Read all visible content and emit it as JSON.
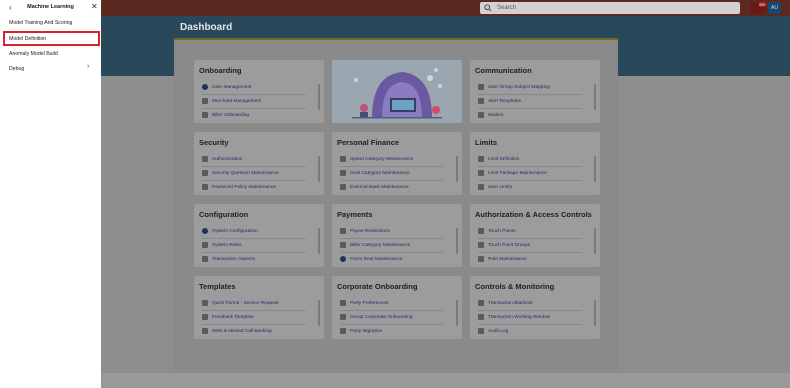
{
  "header": {
    "search_placeholder": "Search",
    "notification_count": "99+",
    "user_initials": "AU"
  },
  "page_title": "Dashboard",
  "drawer": {
    "title": "Machine Learning",
    "items": [
      {
        "label": "Model Training And Scoring"
      },
      {
        "label": "Model Definition",
        "highlighted": true
      },
      {
        "label": "Anomaly Model Build"
      },
      {
        "label": "Debug",
        "has_submenu": true
      }
    ]
  },
  "cards": [
    {
      "title": "Onboarding",
      "items": [
        "User Management",
        "Merchant Management",
        "Biller Onboarding"
      ]
    },
    {
      "title": "Communication",
      "items": [
        "User Group Subject Mapping",
        "Alert Templates",
        "Mailers"
      ]
    },
    {
      "title": "Security",
      "items": [
        "Authentication",
        "Security Question Maintenance",
        "Password Policy Maintenance"
      ]
    },
    {
      "title": "Personal Finance",
      "items": [
        "Spend Category Maintenance",
        "Goal Category Maintenance",
        "External Bank Maintenance"
      ]
    },
    {
      "title": "Limits",
      "items": [
        "Limit Definition",
        "Limit Package Maintenance",
        "User Limits"
      ]
    },
    {
      "title": "Configuration",
      "items": [
        "System Configuration",
        "System Rules",
        "Transaction Aspects"
      ]
    },
    {
      "title": "Payments",
      "items": [
        "Payee Restrictions",
        "Biller Category Maintenance",
        "Forex Deal Maintenance"
      ]
    },
    {
      "title": "Authorization & Access Controls",
      "items": [
        "Touch Points",
        "Touch Point Groups",
        "Role Maintenance"
      ]
    },
    {
      "title": "Templates",
      "items": [
        "Quick Forms - Service Request",
        "Feedback Template",
        "SMS & Missed Call Banking"
      ]
    },
    {
      "title": "Corporate Onboarding",
      "items": [
        "Party Preferences",
        "Group Corporate Onboarding",
        "Party Migration"
      ]
    },
    {
      "title": "Controls & Monitoring",
      "items": [
        "Transaction Blackout",
        "Transaction Working Window",
        "Audit Log"
      ]
    }
  ]
}
